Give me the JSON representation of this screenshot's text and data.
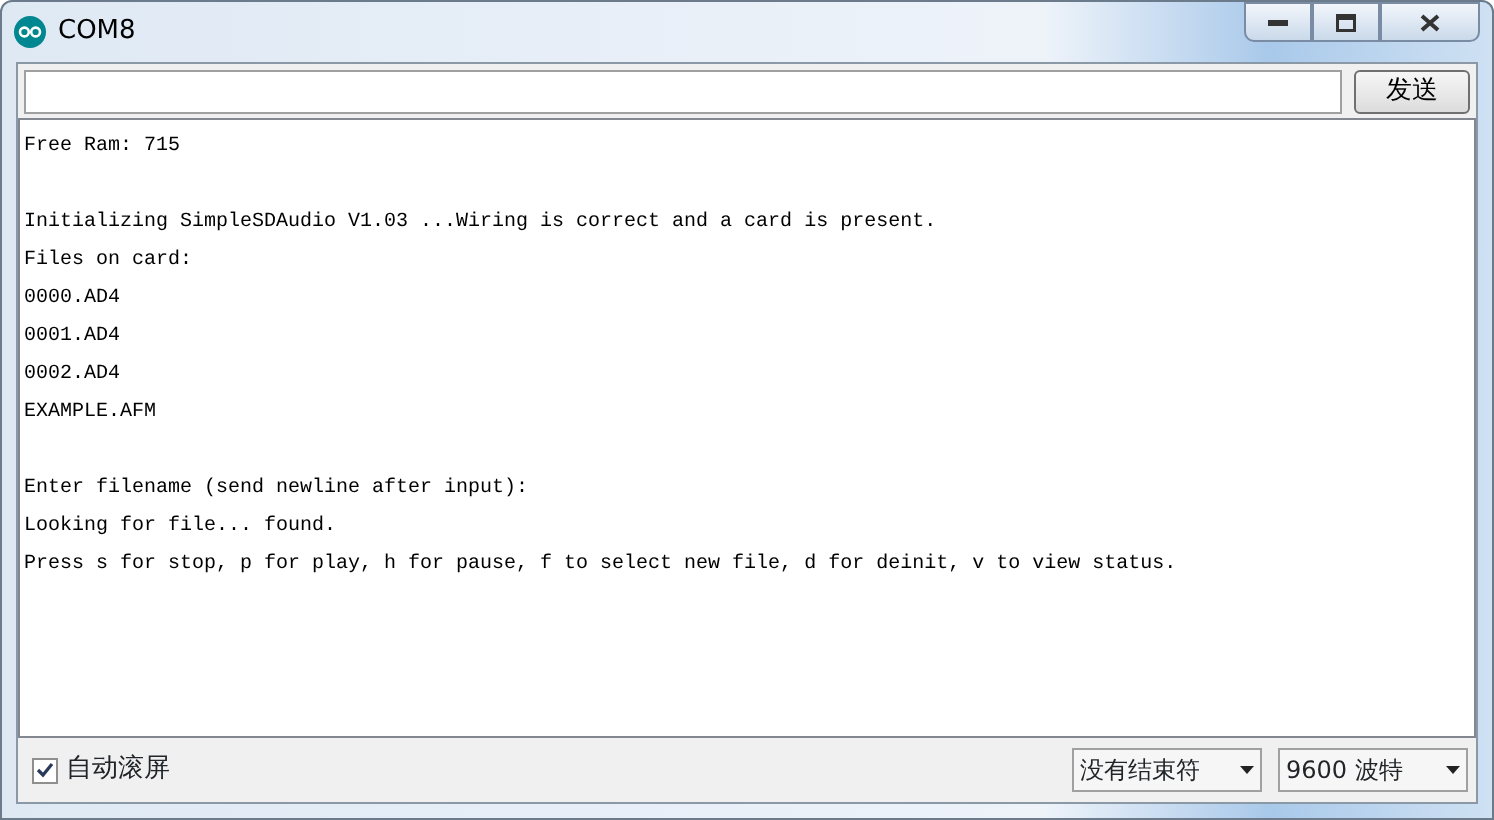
{
  "window": {
    "title": "COM8"
  },
  "send_button": {
    "label": "发送"
  },
  "output_paragraphs": [
    [
      "Free Ram: 715"
    ],
    [
      "Initializing SimpleSDAudio V1.03 ...Wiring is correct and a card is present.",
      "Files on card:",
      "0000.AD4",
      "0001.AD4",
      "0002.AD4",
      "EXAMPLE.AFM"
    ],
    [
      "Enter filename (send newline after input):",
      "Looking for file... found.",
      "Press s for stop, p for play, h for pause, f to select new file, d for deinit, v to view status."
    ]
  ],
  "autoscroll": {
    "label": "自动滚屏",
    "checked": true
  },
  "line_ending": {
    "value": "没有结束符"
  },
  "baud_rate": {
    "value": "9600 波特"
  }
}
